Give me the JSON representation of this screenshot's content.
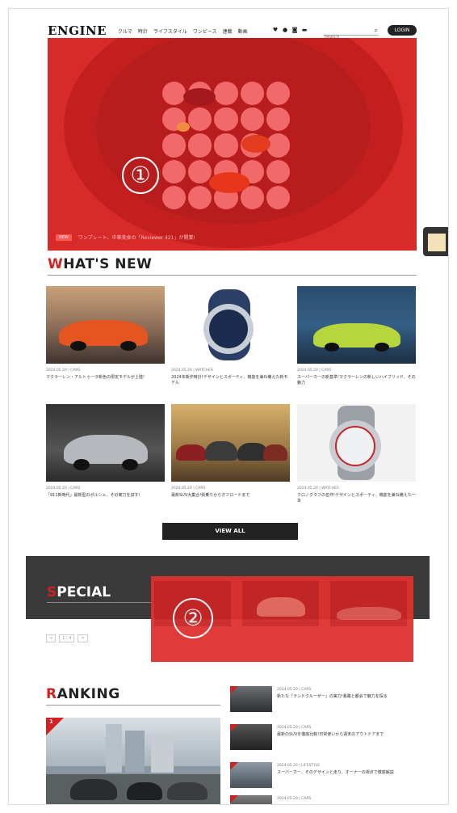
{
  "header": {
    "logo": "ENGINE",
    "nav": [
      "クルマ",
      "時計",
      "ライフスタイル",
      "ワンピース",
      "連載",
      "動画"
    ],
    "social_icons": [
      "twitter-icon",
      "facebook-icon",
      "instagram-icon",
      "youtube-icon"
    ],
    "search_placeholder": "Search",
    "login_label": "LOGIN"
  },
  "hero": {
    "badge": "①",
    "tag": "NEW",
    "caption": "ワンプレート、中華美食の「Reviewer 421」が開業!"
  },
  "whats_new": {
    "title_first": "W",
    "title_rest": "HAT'S NEW",
    "cards": [
      {
        "meta": "2024.05.20 | CARS",
        "title": "マクラーレン・アルトゥーラ新色の限定モデルが上陸!"
      },
      {
        "meta": "2024.05.20 | WATCHES",
        "title": "2024年新作時計!デザインとスポーティ、機能を兼ね備えた新モデル"
      },
      {
        "meta": "2024.05.20 | CARS",
        "title": "スーパーカーの新基準!マクラーレンの新しいハイブリッド、その魅力"
      },
      {
        "meta": "2024.05.20 | CARS",
        "title": "「911新時代」最新型のポルシェ、その実力を試す!"
      },
      {
        "meta": "2024.05.20 | CARS",
        "title": "最新SUV大集合!街乗りからオフロードまで"
      },
      {
        "meta": "2024.05.20 | WATCHES",
        "title": "クロノグラフの名作!デザインとスポーティ、機能を兼ね備えた一本"
      }
    ],
    "view_all": "VIEW ALL"
  },
  "special": {
    "title_first": "S",
    "title_rest": "PECIAL",
    "badge": "②",
    "pager": [
      "<",
      "1 / 4",
      ">"
    ]
  },
  "ranking": {
    "title_first": "R",
    "title_rest": "ANKING",
    "main_rank": "1",
    "items": [
      {
        "meta": "2024.05.20 | CARS",
        "title": "新たな「ランドクルーザー」の実力!悪路と都会で魅力を探る"
      },
      {
        "meta": "2024.05.20 | CARS",
        "title": "最新のSUVを徹底比較!日常使いから週末のアウトドアまで"
      },
      {
        "meta": "2024.05.20 | LIFESTYLE",
        "title": "スーパーカー、そのデザインと走り、オーナーの視点で徹底解説"
      },
      {
        "meta": "2024.05.20 | CARS",
        "title": ""
      }
    ]
  },
  "colors": {
    "accent": "#d32020",
    "hero_red": "#d92a2a",
    "dark_band": "#3a3a3a"
  }
}
